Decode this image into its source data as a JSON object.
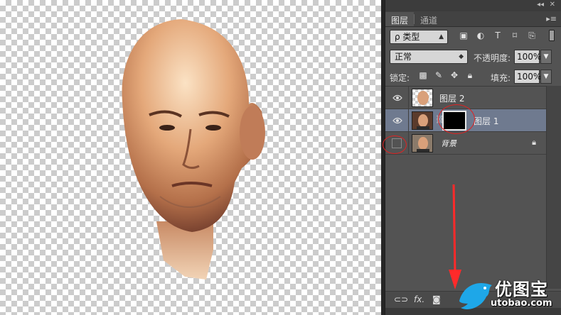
{
  "panel": {
    "topbar_controls": {
      "collapse": "◂◂",
      "close": "✕"
    },
    "tabs": [
      {
        "label": "图层",
        "active": true
      },
      {
        "label": "通道",
        "active": false
      }
    ],
    "menu_icon": "panel-menu-icon"
  },
  "filter": {
    "kind_label": "ρ 类型",
    "icons": [
      "image-filter-icon",
      "adjustment-filter-icon",
      "type-filter-icon",
      "shape-filter-icon",
      "smart-object-filter-icon"
    ]
  },
  "blend": {
    "mode": "正常",
    "opacity_label": "不透明度:",
    "opacity_value": "100%"
  },
  "lock": {
    "label": "锁定:",
    "fill_label": "填充:",
    "fill_value": "100%"
  },
  "layers": [
    {
      "name": "图层 2",
      "visible": true,
      "selected": false,
      "has_mask": false,
      "locked": false
    },
    {
      "name": "图层 1",
      "visible": true,
      "selected": true,
      "has_mask": true,
      "locked": false
    },
    {
      "name": "背景",
      "visible": false,
      "selected": false,
      "has_mask": false,
      "locked": true
    }
  ],
  "bottom_bar": {
    "link_icon": "link-layers-icon",
    "fx_label": "fx."
  },
  "watermark": {
    "brand": "优图宝",
    "url": "utobao.com"
  },
  "colors": {
    "panel_bg": "#535353",
    "selected_layer": "#6f7a8f",
    "annotation_red": "#e02222",
    "watermark_blue": "#1ea7e8"
  }
}
